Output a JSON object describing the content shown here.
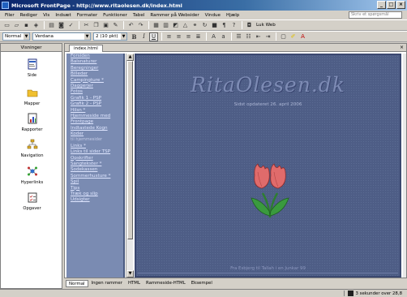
{
  "window": {
    "title": "Microsoft FrontPage - http://www.ritaolesen.dk/index.html"
  },
  "menubar": {
    "items": [
      "Filer",
      "Rediger",
      "Vis",
      "Indsæt",
      "Formater",
      "Funktioner",
      "Tabel",
      "Rammer på Websider",
      "Vindue",
      "Hjælp"
    ]
  },
  "help": {
    "placeholder": "Skriv et spørgsmål"
  },
  "toolbar": {
    "style": "Normal",
    "font": "Verdana",
    "size": "2 (10 pkt)",
    "lug_web": "Luk Web"
  },
  "views": {
    "title": "Visninger",
    "items": [
      "Side",
      "Mapper",
      "Rapporter",
      "Navigation",
      "Hyperlinks",
      "Opgaver"
    ]
  },
  "doc_tab": "index.html",
  "nav_links": [
    {
      "text": "Forsiden",
      "sub": false
    },
    {
      "text": "Balsnaturer",
      "sub": false
    },
    {
      "text": "Beregninger",
      "sub": false
    },
    {
      "text": "Billeder",
      "sub": false
    },
    {
      "text": "Campingture *",
      "sub": false
    },
    {
      "text": "Daggerjer",
      "sub": false
    },
    {
      "text": "Fotos",
      "sub": false
    },
    {
      "text": "Grafik 1 - PSP",
      "sub": false
    },
    {
      "text": "Grafik 2 - PSP",
      "sub": false
    },
    {
      "text": "Hilsn *",
      "sub": false
    },
    {
      "text": "Hjemmeside med",
      "sub": false
    },
    {
      "text": "Frontpage",
      "sub": false
    },
    {
      "text": "Indtastede Kogn",
      "sub": false
    },
    {
      "text": "Koder",
      "sub": false
    },
    {
      "text": "til hjemmesider",
      "sub": true
    },
    {
      "text": "Links *",
      "sub": false
    },
    {
      "text": "Links til sider TSP",
      "sub": false
    },
    {
      "text": "Opskrifter",
      "sub": false
    },
    {
      "text": "Sangtekster *",
      "sub": false
    },
    {
      "text": "Sodekassen",
      "sub": false
    },
    {
      "text": "Sommerhusture *",
      "sub": false
    },
    {
      "text": "Spil",
      "sub": false
    },
    {
      "text": "Tips",
      "sub": false
    },
    {
      "text": "Træk og slip",
      "sub": false
    },
    {
      "text": "Udsigter",
      "sub": false
    }
  ],
  "main": {
    "site_title": "RitaOlesen.dk",
    "updated": "Sidst opdateret 26. april 2006",
    "footer": "Fra Esbjerg til Tallah i en Junkar 99"
  },
  "modes": [
    "Normal",
    "Ingen rammer",
    "HTML",
    "Rammeside-HTML",
    "Eksempel"
  ],
  "status": {
    "timing": "3 sekunder over 28,8"
  }
}
